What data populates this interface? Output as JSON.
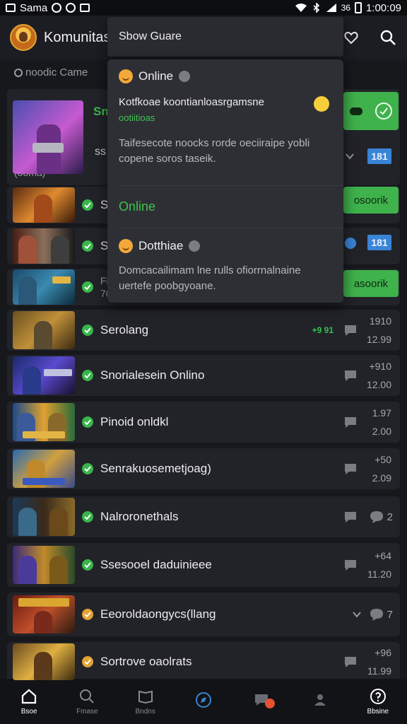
{
  "status_bar": {
    "left_text": "Sama",
    "right_text": "36",
    "time": "1:00:09"
  },
  "header": {
    "title": "Komunitas"
  },
  "dropdown": {
    "header": "Sbow Guare",
    "items": [
      {
        "title": "Online",
        "line1": "Kotfkoae koontianloasrgamsne",
        "line2": "ootiitioas",
        "body": "Taifesecote noocks rorde oeciiraipe yobli copene soros taseik."
      },
      {
        "title": "",
        "label": "Online"
      },
      {
        "title": "Dotthiae",
        "body": "Domcacailimam lne rulls ofiorrnalnaine uertefe poobgyoane."
      }
    ]
  },
  "section_label": "noodic Came",
  "featured": {
    "name": "Sn",
    "sub": "(ooma)",
    "row2_label": "ss",
    "badge": "181"
  },
  "rows": [
    {
      "name": "Sa",
      "sub": "",
      "button": "osoorik"
    },
    {
      "name": "Sl",
      "badge": "181"
    },
    {
      "name": "Fi",
      "sub": "70",
      "button": "asoorik"
    },
    {
      "name": "Serolang",
      "ping": "+9 91",
      "top": "1910",
      "bottom": "12.99"
    },
    {
      "name": "Snorialesein Onlino",
      "top": "+910",
      "bottom": "12.00"
    },
    {
      "name": "Pinoid onldkl",
      "top": "1.97",
      "bottom": "2.00"
    },
    {
      "name": "Senrakuosemetjoag)",
      "top": "+50",
      "bottom": "2.09"
    },
    {
      "name": "Nalroronethals",
      "count": "2"
    },
    {
      "name": "Ssesooel daduinieee",
      "top": "+64",
      "bottom": "11.20"
    },
    {
      "name": "Eeoroldaongycs(llang",
      "count": "7"
    },
    {
      "name": "Sortrove oaolrats",
      "top": "+96",
      "bottom": "11.99"
    }
  ],
  "bottom_nav": [
    {
      "label": "Bsoe",
      "active": true
    },
    {
      "label": "Fmase"
    },
    {
      "label": "Bndns"
    },
    {
      "label": ""
    },
    {
      "label": ""
    },
    {
      "label": ""
    },
    {
      "label": "Bbsine"
    }
  ],
  "colors": {
    "accent_green": "#3fb24c",
    "accent_blue": "#3a84d6",
    "badge_red": "#e55133",
    "background": "#17181c"
  }
}
